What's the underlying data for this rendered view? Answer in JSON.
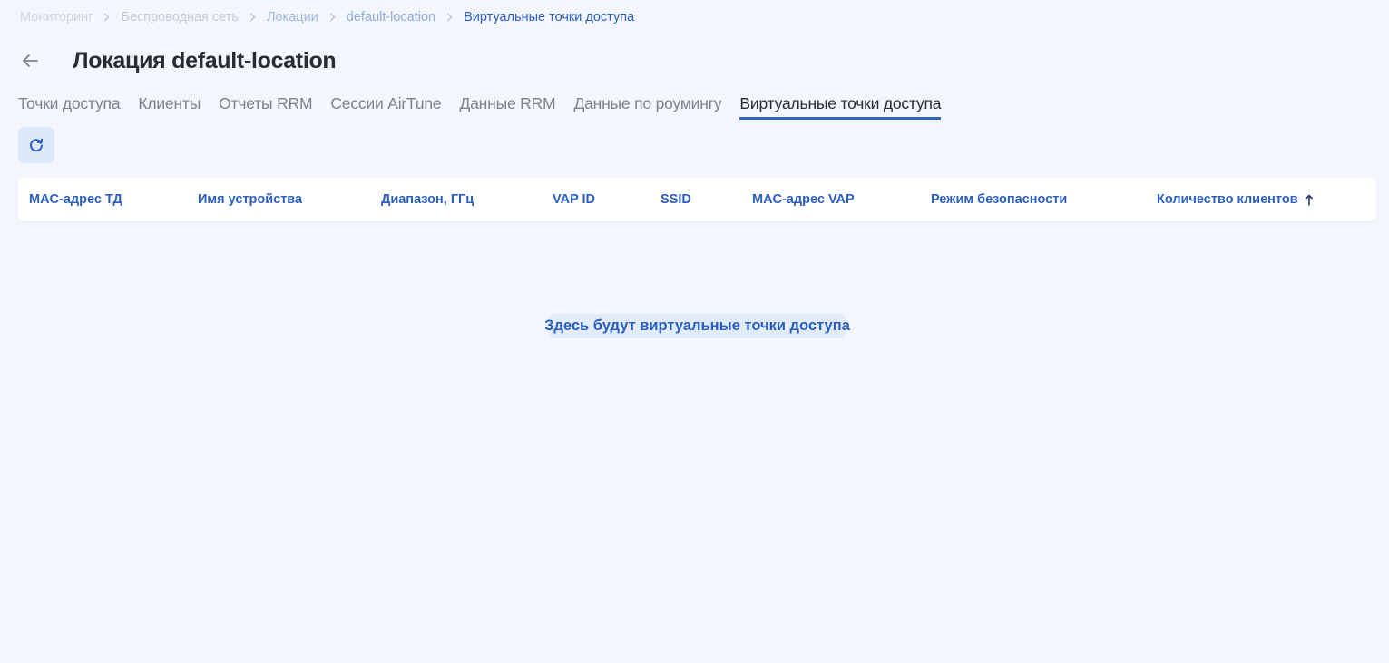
{
  "breadcrumb": {
    "items": [
      "Мониторинг",
      "Беспроводная сеть",
      "Локации",
      "default-location"
    ],
    "current": "Виртуальные точки доступа"
  },
  "header": {
    "title": "Локация default-location",
    "back_icon": "arrow-left-icon"
  },
  "tabs": [
    {
      "label": "Точки доступа",
      "active": false
    },
    {
      "label": "Клиенты",
      "active": false
    },
    {
      "label": "Отчеты RRM",
      "active": false
    },
    {
      "label": "Сессии AirTune",
      "active": false
    },
    {
      "label": "Данные RRM",
      "active": false
    },
    {
      "label": "Данные по роумингу",
      "active": false
    },
    {
      "label": "Виртуальные точки доступа",
      "active": true
    }
  ],
  "toolbar": {
    "refresh_icon": "refresh-icon"
  },
  "table": {
    "columns": [
      "MAC-адрес ТД",
      "Имя устройства",
      "Диапазон, ГГц",
      "VAP ID",
      "SSID",
      "MAC-адрес VAP",
      "Режим безопасности",
      "Количество клиентов"
    ],
    "sorted_column": "Количество клиентов",
    "sort_direction": "ascending",
    "rows": []
  },
  "empty_state": {
    "message": "Здесь будут виртуальные точки доступа"
  },
  "colors": {
    "background": "#f3f7fd",
    "accent": "#2a5fbf",
    "tab_underline": "#2e63c4",
    "button_bg": "#dde8f8"
  }
}
